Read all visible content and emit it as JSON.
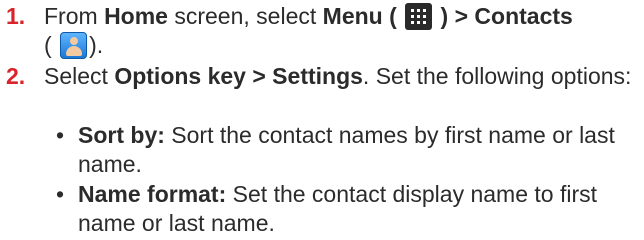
{
  "steps": [
    {
      "number": "1.",
      "parts": {
        "t1": "From ",
        "b1": "Home",
        "t2": " screen, select ",
        "b2": "Menu (",
        "b3": ") > Contacts",
        "t3": "(",
        "t4": ")."
      },
      "icons": [
        "menu-grid-icon",
        "contacts-icon"
      ]
    },
    {
      "number": "2.",
      "parts": {
        "t1": "Select ",
        "b1": "Options key > Settings",
        "t2": ". Set the following options:"
      }
    }
  ],
  "bullets": [
    {
      "term": "Sort by:",
      "text": " Sort the contact names by first name or last name."
    },
    {
      "term": "Name format:",
      "text": " Set the contact display name to first name or last name."
    }
  ],
  "colors": {
    "step_number": "#d8242a",
    "text": "#2b2b2b"
  }
}
